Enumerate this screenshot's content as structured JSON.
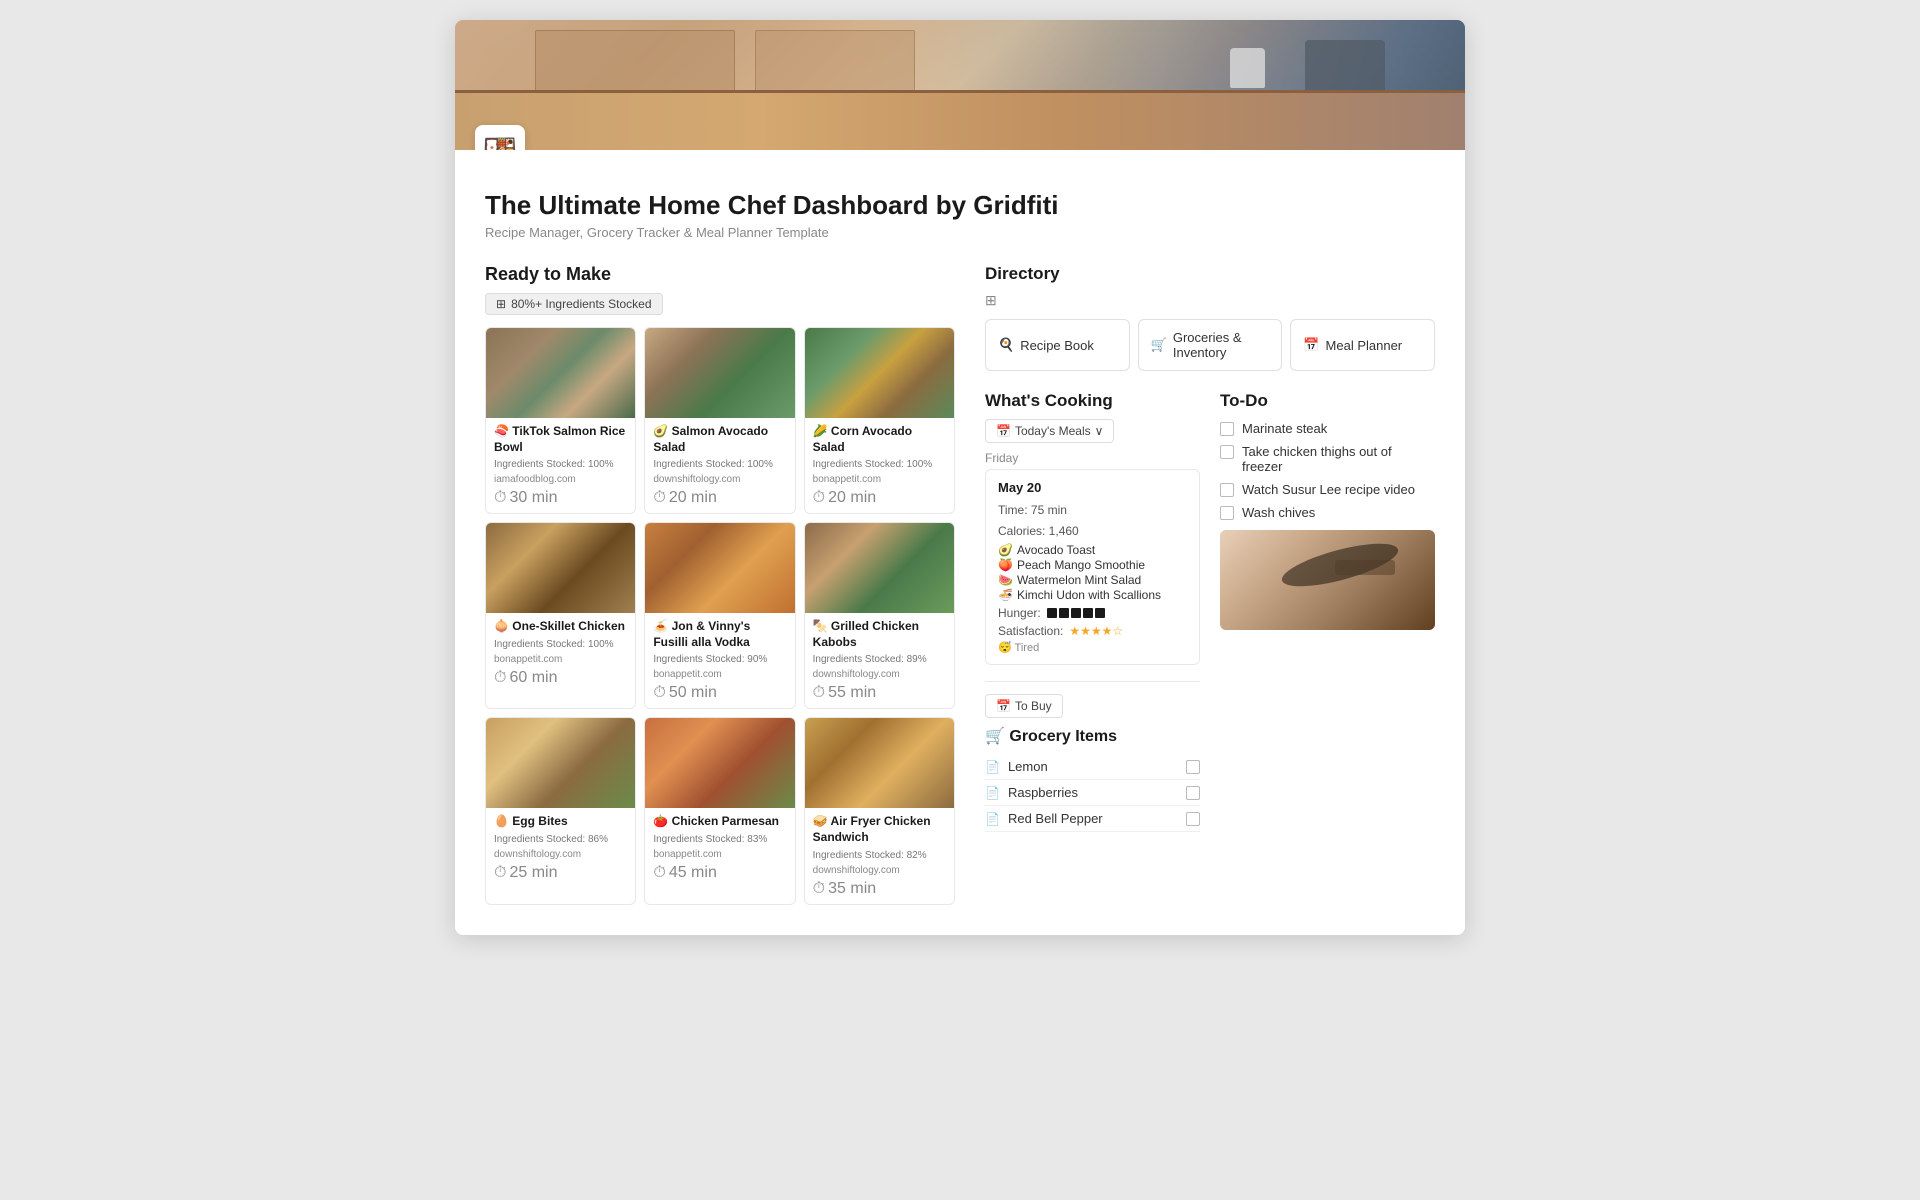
{
  "page": {
    "icon": "🍱",
    "title": "The Ultimate Home Chef Dashboard by Gridfiti",
    "subtitle": "Recipe Manager, Grocery Tracker & Meal Planner Template"
  },
  "ready_to_make": {
    "section_title": "Ready to Make",
    "filter_label": "80%+ Ingredients Stocked",
    "filter_icon": "⊞"
  },
  "recipes": [
    {
      "name": "🍣 TikTok Salmon Rice Bowl",
      "stocked": "Ingredients Stocked: 100%",
      "source": "iamafoodblog.com",
      "time": "30 min",
      "img_class": "food-salmon-rice"
    },
    {
      "name": "🥑 Salmon Avocado Salad",
      "stocked": "Ingredients Stocked: 100%",
      "source": "downshiftology.com",
      "time": "20 min",
      "img_class": "food-salmon-avocado"
    },
    {
      "name": "🌽 Corn Avocado Salad",
      "stocked": "Ingredients Stocked: 100%",
      "source": "bonappetit.com",
      "time": "20 min",
      "img_class": "food-corn-avocado"
    },
    {
      "name": "🧅 One-Skillet Chicken",
      "stocked": "Ingredients Stocked: 100%",
      "source": "bonappetit.com",
      "time": "60 min",
      "img_class": "food-chicken"
    },
    {
      "name": "🍝 Jon & Vinny's Fusilli alla Vodka",
      "stocked": "Ingredients Stocked: 90%",
      "source": "bonappetit.com",
      "time": "50 min",
      "img_class": "food-pasta"
    },
    {
      "name": "🍢 Grilled Chicken Kabobs",
      "stocked": "Ingredients Stocked: 89%",
      "source": "downshiftology.com",
      "time": "55 min",
      "img_class": "food-kabobs"
    },
    {
      "name": "🥚 Egg Bites",
      "stocked": "Ingredients Stocked: 86%",
      "source": "downshiftology.com",
      "time": "25 min",
      "img_class": "food-egg-bites"
    },
    {
      "name": "🍅 Chicken Parmesan",
      "stocked": "Ingredients Stocked: 83%",
      "source": "bonappetit.com",
      "time": "45 min",
      "img_class": "food-chicken-parm"
    },
    {
      "name": "🥪 Air Fryer Chicken Sandwich",
      "stocked": "Ingredients Stocked: 82%",
      "source": "downshiftology.com",
      "time": "35 min",
      "img_class": "food-sandwich"
    }
  ],
  "directory": {
    "title": "Directory",
    "cards": [
      {
        "icon": "🍳",
        "label": "Recipe Book"
      },
      {
        "icon": "🛒",
        "label": "Groceries & Inventory"
      },
      {
        "icon": "📅",
        "label": "Meal Planner"
      }
    ]
  },
  "whats_cooking": {
    "title": "What's Cooking",
    "meals_filter": "Today's Meals",
    "day_label": "Friday",
    "meal_card": {
      "date": "May 20",
      "time": "Time: 75 min",
      "calories": "Calories: 1,460",
      "items": [
        {
          "icon": "🥑",
          "name": "Avocado Toast"
        },
        {
          "icon": "🍑",
          "name": "Peach Mango Smoothie"
        },
        {
          "icon": "🍉",
          "name": "Watermelon Mint Salad"
        },
        {
          "icon": "🍜",
          "name": "Kimchi Udon with Scallions"
        }
      ],
      "hunger_label": "Hunger:",
      "hunger_bars": 5,
      "satisfaction_label": "Satisfaction:",
      "satisfaction_stars": 4,
      "mood": "😴 Tired"
    }
  },
  "todo": {
    "title": "To-Do",
    "items": [
      "Marinate steak",
      "Take chicken thighs out of freezer",
      "Watch Susur Lee recipe video",
      "Wash chives"
    ]
  },
  "grocery": {
    "to_buy_label": "To Buy",
    "title": "Grocery Items",
    "title_icon": "🛒",
    "items": [
      "Lemon",
      "Raspberries",
      "Red Bell Pepper"
    ]
  }
}
